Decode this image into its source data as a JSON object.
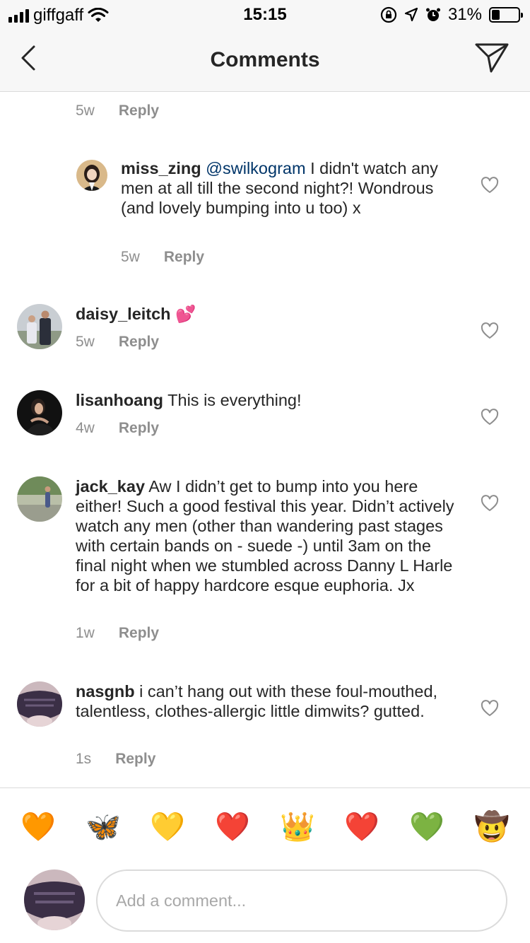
{
  "status_bar": {
    "carrier": "giffgaff",
    "time": "15:15",
    "battery": "31%",
    "battery_level": 0.31,
    "icons": [
      "signal-icon",
      "wifi-icon",
      "orientation-lock-icon",
      "location-icon",
      "alarm-icon",
      "battery-icon"
    ]
  },
  "header": {
    "title": "Comments",
    "back_icon": "chevron-left-icon",
    "send_icon": "paper-plane-icon"
  },
  "comments": [
    {
      "age": "5w",
      "reply": "Reply"
    },
    {
      "user": "miss_zing",
      "mention": "@swilkogram",
      "text": " I didn't watch any men at all till the second night?! Wondrous (and lovely bumping into u too) x",
      "age": "5w",
      "reply": "Reply"
    },
    {
      "user": "daisy_leitch",
      "text": "💕",
      "age": "5w",
      "reply": "Reply"
    },
    {
      "user": "lisanhoang",
      "text": "This is everything!",
      "age": "4w",
      "reply": "Reply"
    },
    {
      "user": "jack_kay",
      "text": "Aw I didn’t get to bump into you here either! Such a good festival this year. Didn’t actively watch any men (other than wandering past stages with certain bands on - suede -) until 3am on the final night when we stumbled across Danny L Harle for a bit of happy hardcore esque euphoria. Jx",
      "age": "1w",
      "reply": "Reply"
    },
    {
      "user": "nasgnb",
      "text": "i can’t hang out with these foul-mouthed, talentless, clothes-allergic little dimwits? gutted.",
      "age": "1s",
      "reply": "Reply"
    }
  ],
  "emoji_bar": [
    "🧡",
    "🦋",
    "💛",
    "❤️",
    "👑",
    "❤️",
    "💚",
    "🤠"
  ],
  "composer": {
    "placeholder": "Add a comment..."
  }
}
